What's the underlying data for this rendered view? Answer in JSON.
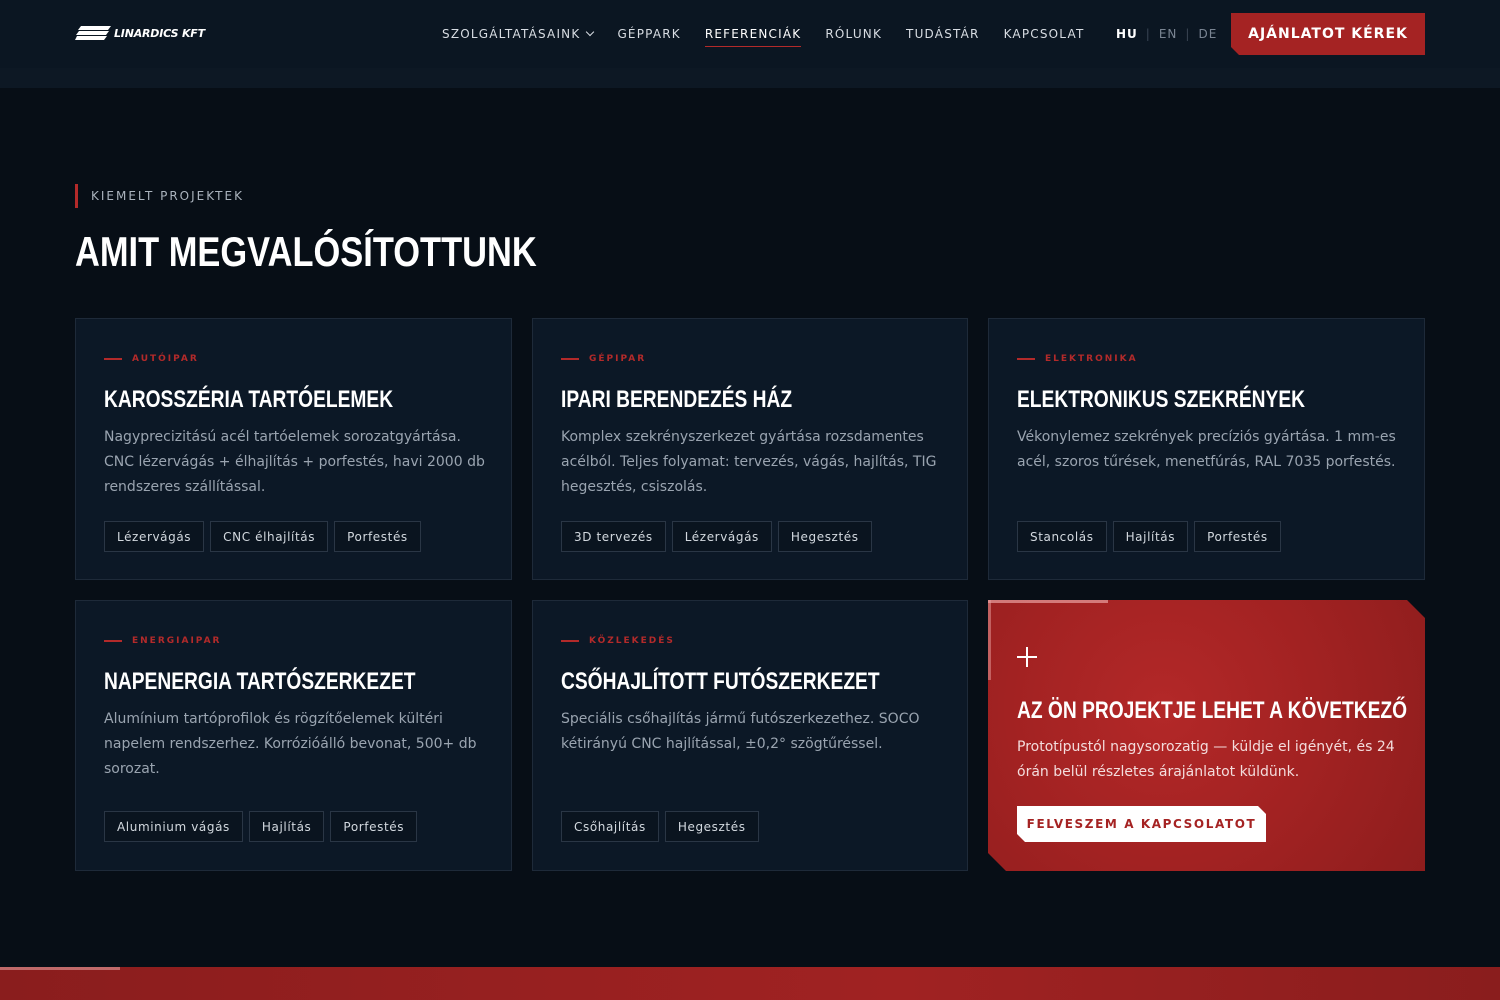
{
  "brand": {
    "name": "LINARDICS KFT"
  },
  "nav": {
    "items": [
      {
        "label": "SZOLGÁLTATÁSAINK",
        "dropdown": true
      },
      {
        "label": "GÉPPARK"
      },
      {
        "label": "REFERENCIÁK",
        "active": true
      },
      {
        "label": "RÓLUNK"
      },
      {
        "label": "TUDÁSTÁR"
      },
      {
        "label": "KAPCSOLAT"
      }
    ],
    "languages": [
      "HU",
      "EN",
      "DE"
    ],
    "current_language": "HU",
    "cta_label": "AJÁNLATOT KÉREK"
  },
  "section": {
    "eyebrow": "KIEMELT PROJEKTEK",
    "title": "AMIT MEGVALÓSÍTOTTUNK"
  },
  "cards": [
    {
      "category": "AUTÓIPAR",
      "title": "KAROSSZÉRIA TARTÓELEMEK",
      "description": "Nagyprecizitású acél tartóelemek sorozatgyártása. CNC lézervágás + élhajlítás + porfestés, havi 2000 db rendszeres szállítással.",
      "tags": [
        "Lézervágás",
        "CNC élhajlítás",
        "Porfestés"
      ]
    },
    {
      "category": "GÉPIPAR",
      "title": "IPARI BERENDEZÉS HÁZ",
      "description": "Komplex szekrényszerkezet gyártása rozsdamentes acélból. Teljes folyamat: tervezés, vágás, hajlítás, TIG hegesztés, csiszolás.",
      "tags": [
        "3D tervezés",
        "Lézervágás",
        "Hegesztés"
      ]
    },
    {
      "category": "ELEKTRONIKA",
      "title": "ELEKTRONIKUS SZEKRÉNYEK",
      "description": "Vékonylemez szekrények precíziós gyártása. 1 mm-es acél, szoros tűrések, menetfúrás, RAL 7035 porfestés.",
      "tags": [
        "Stancolás",
        "Hajlítás",
        "Porfestés"
      ]
    },
    {
      "category": "ENERGIAIPAR",
      "title": "NAPENERGIA TARTÓSZERKEZET",
      "description": "Alumínium tartóprofilok és rögzítőelemek kültéri napelem rendszerhez. Korrózióálló bevonat, 500+ db sorozat.",
      "tags": [
        "Aluminium vágás",
        "Hajlítás",
        "Porfestés"
      ]
    },
    {
      "category": "KÖZLEKEDÉS",
      "title": "CSŐHAJLÍTOTT FUTÓSZERKEZET",
      "description": "Speciális csőhajlítás jármű futószerkezethez. SOCO kétirányú CNC hajlítással, ±0,2° szögtűréssel.",
      "tags": [
        "Csőhajlítás",
        "Hegesztés"
      ]
    }
  ],
  "cta_card": {
    "title": "AZ ÖN PROJEKTJE LEHET A KÖVETKEZŐ",
    "description": "Prototípustól nagysorozatig — küldje el igényét, és 24 órán belül részletes árajánlatot küldünk.",
    "button_label": "FELVESZEM A KAPCSOLATOT"
  },
  "colors": {
    "accent": "#a52323",
    "background": "#070e16",
    "card": "#0c1826"
  }
}
